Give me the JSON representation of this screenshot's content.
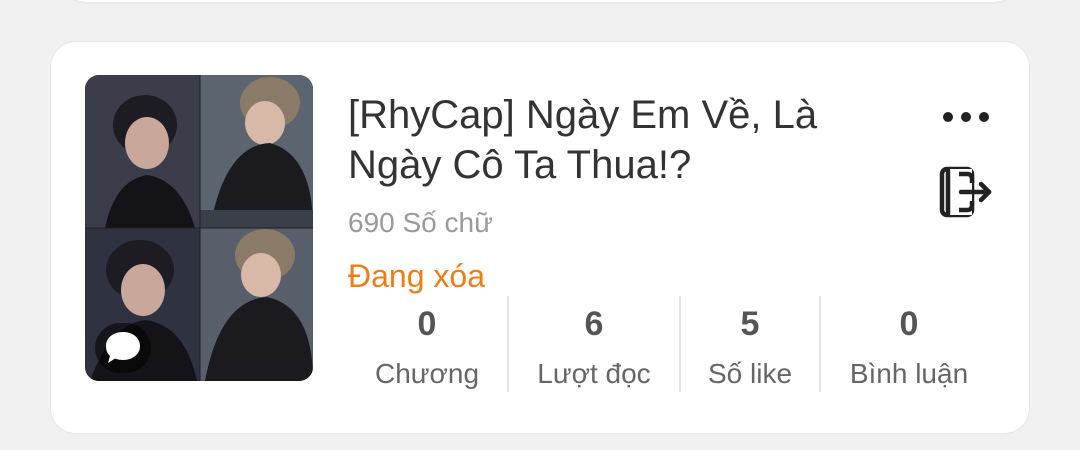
{
  "story": {
    "title": "[RhyCap] Ngày Em Về, Là Ngày Cô Ta Thua!?",
    "word_count": "690 Số chữ",
    "status": "Đang xóa",
    "status_color": "#f07c14"
  },
  "actions": {
    "more_icon": "more-horizontal-icon",
    "exit_icon": "exit-icon"
  },
  "stats": [
    {
      "value": "0",
      "label": "Chương"
    },
    {
      "value": "6",
      "label": "Lượt đọc"
    },
    {
      "value": "5",
      "label": "Số like"
    },
    {
      "value": "0",
      "label": "Bình luận"
    }
  ]
}
